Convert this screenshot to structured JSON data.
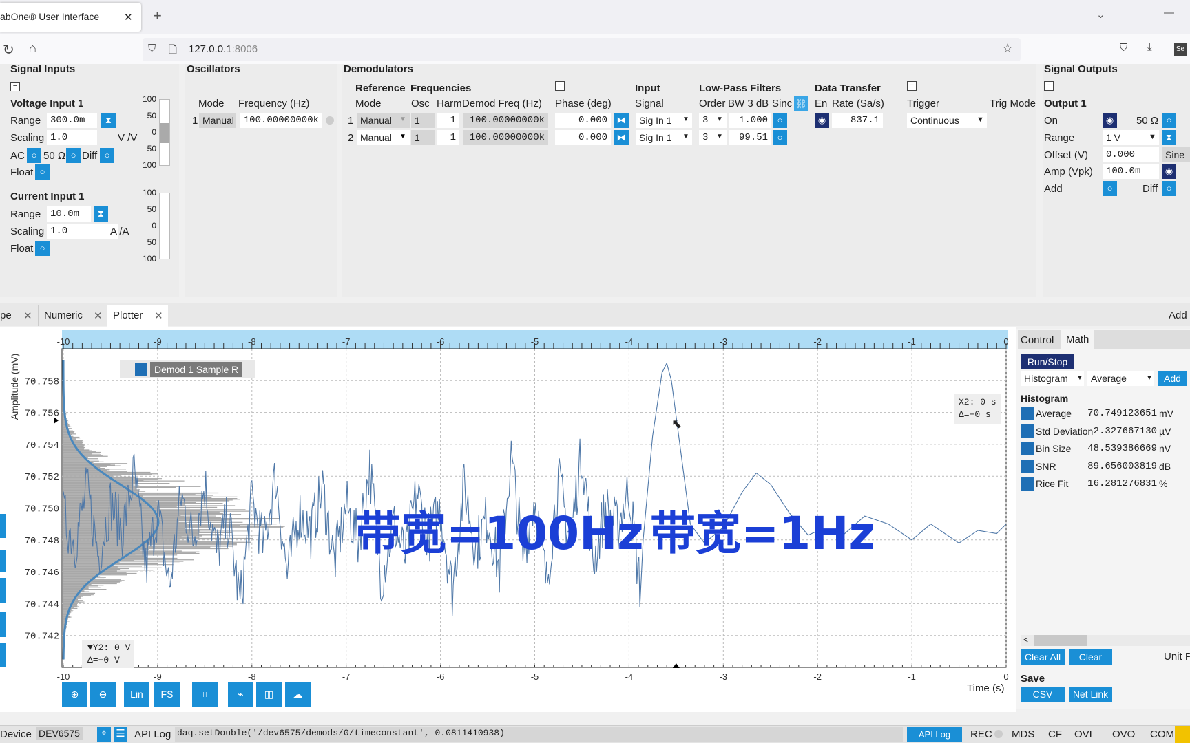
{
  "browser": {
    "tab_title": "abOne® User Interface",
    "tab_close": "✕",
    "new_tab": "+",
    "url_host": "127.0.0.1",
    "url_port": ":8006"
  },
  "signal_inputs": {
    "title": "Signal Inputs",
    "voltage_title": "Voltage Input 1",
    "range_label": "Range",
    "v_range": "300.0m",
    "scaling_label": "Scaling",
    "v_scaling": "1.0",
    "v_unit": "V /V",
    "ac": "AC",
    "ohm": "50 Ω",
    "diff": "Diff",
    "float": "Float",
    "current_title": "Current Input 1",
    "i_range": "10.0m",
    "i_scaling": "1.0",
    "i_unit": "A /A",
    "gauge_ticks": [
      "100",
      "50",
      "0",
      "50",
      "100"
    ],
    "voltage_gauge_level": 0.3
  },
  "oscillators": {
    "title": "Oscillators",
    "mode_header": "Mode",
    "freq_header": "Frequency (Hz)",
    "rows": [
      {
        "index": "1",
        "mode": "Manual",
        "freq": "100.00000000k"
      }
    ]
  },
  "demodulators": {
    "title": "Demodulators",
    "reference": "Reference",
    "frequencies": "Frequencies",
    "input": "Input",
    "lpf": "Low-Pass Filters",
    "data_transfer": "Data Transfer",
    "headers": {
      "mode": "Mode",
      "osc": "Osc",
      "harm": "Harm",
      "demod_freq": "Demod Freq (Hz)",
      "phase": "Phase (deg)",
      "signal": "Signal",
      "order": "Order",
      "bw": "BW 3 dB",
      "sinc": "Sinc",
      "en": "En",
      "rate": "Rate (Sa/s)",
      "trigger": "Trigger",
      "trig_mode": "Trig Mode"
    },
    "rows": [
      {
        "index": "1",
        "mode": "Manual",
        "osc": "1",
        "harm": "1",
        "freq": "100.00000000k",
        "phase": "0.000",
        "signal": "Sig In 1",
        "order": "3",
        "bw": "1.000",
        "rate": "837.1",
        "trigger": "Continuous"
      },
      {
        "index": "2",
        "mode": "Manual",
        "osc": "1",
        "harm": "1",
        "freq": "100.00000000k",
        "phase": "0.000",
        "signal": "Sig In 1",
        "order": "3",
        "bw": "99.51"
      }
    ]
  },
  "signal_outputs": {
    "title": "Signal Outputs",
    "output_title": "Output 1",
    "on": "On",
    "ohm": "50 Ω",
    "range_label": "Range",
    "range": "1 V",
    "offset_label": "Offset (V)",
    "offset": "0.000",
    "sine": "Sine",
    "amp_label": "Amp (Vpk)",
    "amp": "100.0m",
    "add": "Add",
    "diff": "Diff"
  },
  "tabs": [
    {
      "label": "pe"
    },
    {
      "label": "Numeric"
    },
    {
      "label": "Plotter"
    }
  ],
  "tab_add": "Add",
  "plot": {
    "legend": "Demod 1 Sample R",
    "x_cursor": "X2: 0 s",
    "x_delta": "Δ=+0 s",
    "y_cursor": "▼Y2: 0 V",
    "y_delta": "Δ=+0 V",
    "overlay_left": "带宽=100Hz",
    "overlay_right": "带宽=1Hz",
    "overlay_color": "#1b3fd6",
    "toolbar": [
      "zoom-in",
      "zoom-out",
      "Lin",
      "FS",
      "cursor",
      "trace-a",
      "trace-b",
      "cloud"
    ]
  },
  "chart_data": {
    "type": "line",
    "xlabel": "Time (s)",
    "ylabel": "Amplitude (mV)",
    "xlim": [
      -10,
      0
    ],
    "ylim": [
      70.74,
      70.76
    ],
    "grid": true,
    "x_ticks": [
      "-10",
      "-9",
      "-8",
      "-7",
      "-6",
      "-5",
      "-4",
      "-3",
      "-2",
      "-1",
      "0"
    ],
    "y_ticks": [
      "70.742",
      "70.744",
      "70.746",
      "70.748",
      "70.750",
      "70.752",
      "70.754",
      "70.756",
      "70.758"
    ],
    "series": [
      {
        "name": "Demod 1 Sample R",
        "color": "#4f78a8",
        "noisy_segment": {
          "x_start": -10,
          "x_step": 0.125,
          "values": [
            70.7495,
            70.7478,
            70.7512,
            70.747,
            70.7503,
            70.7486,
            70.7521,
            70.7462,
            70.7498,
            70.745,
            70.7508,
            70.748,
            70.7515,
            70.7472,
            70.7493,
            70.744,
            70.7505,
            70.7476,
            70.752,
            70.7458,
            70.7497,
            70.7485,
            70.7512,
            70.7466,
            70.7502,
            70.7479,
            70.7525,
            70.7455,
            70.749,
            70.747,
            70.751,
            70.7482,
            70.75,
            70.7448,
            70.7514,
            70.7475,
            70.7495,
            70.746,
            70.7532,
            70.747,
            70.7507,
            70.7452,
            70.7518,
            70.748,
            70.7536,
            70.7466,
            70.75,
            70.7488,
            70.7512,
            70.7445
          ]
        },
        "smooth_segment": {
          "x": [
            -3.85,
            -3.75,
            -3.65,
            -3.6,
            -3.55,
            -3.45,
            -3.35,
            -3.2,
            -3.0,
            -2.8,
            -2.65,
            -2.5,
            -2.3,
            -2.1,
            -1.95,
            -1.75,
            -1.5,
            -1.25,
            -1.0,
            -0.8,
            -0.6,
            -0.5,
            -0.3,
            -0.1,
            0
          ],
          "y": [
            70.748,
            70.7545,
            70.7585,
            70.7591,
            70.758,
            70.7535,
            70.749,
            70.7478,
            70.7488,
            70.751,
            70.7522,
            70.7515,
            70.7497,
            70.7483,
            70.7487,
            70.7482,
            70.7495,
            70.749,
            70.748,
            70.749,
            70.7482,
            70.7478,
            70.7486,
            70.7484,
            70.749
          ]
        }
      }
    ],
    "histogram": {
      "mean": 70.749124,
      "std": 0.0023277,
      "color": "#a8a8a8",
      "fit_color": "#4a88bd"
    }
  },
  "math": {
    "tabs": [
      "Control",
      "Math"
    ],
    "run_stop": "Run/Stop",
    "select1": "Histogram",
    "select2": "Average",
    "add": "Add",
    "section": "Histogram",
    "rows": [
      {
        "label": "Average",
        "value": "70.749123651",
        "unit": "mV"
      },
      {
        "label": "Std Deviation",
        "value": "2.327667130",
        "unit": "µV"
      },
      {
        "label": "Bin Size",
        "value": "48.539386669",
        "unit": "nV"
      },
      {
        "label": "SNR",
        "value": "89.656003819",
        "unit": "dB"
      },
      {
        "label": "Rice Fit",
        "value": "16.281276831",
        "unit": "%"
      }
    ],
    "clear_all": "Clear All",
    "clear": "Clear",
    "unit_p": "Unit P",
    "save": "Save",
    "csv": "CSV",
    "net_link": "Net Link"
  },
  "status": {
    "device_label": "Device",
    "device": "DEV6575",
    "api_log": "API Log",
    "command": "daq.setDouble('/dev6575/demods/0/timeconstant', 0.0811410938)",
    "api_log_btn": "API Log",
    "rec": "REC",
    "mds": "MDS",
    "cf": "CF",
    "ovi": "OVI",
    "ovo": "OVO",
    "com": "COM"
  }
}
